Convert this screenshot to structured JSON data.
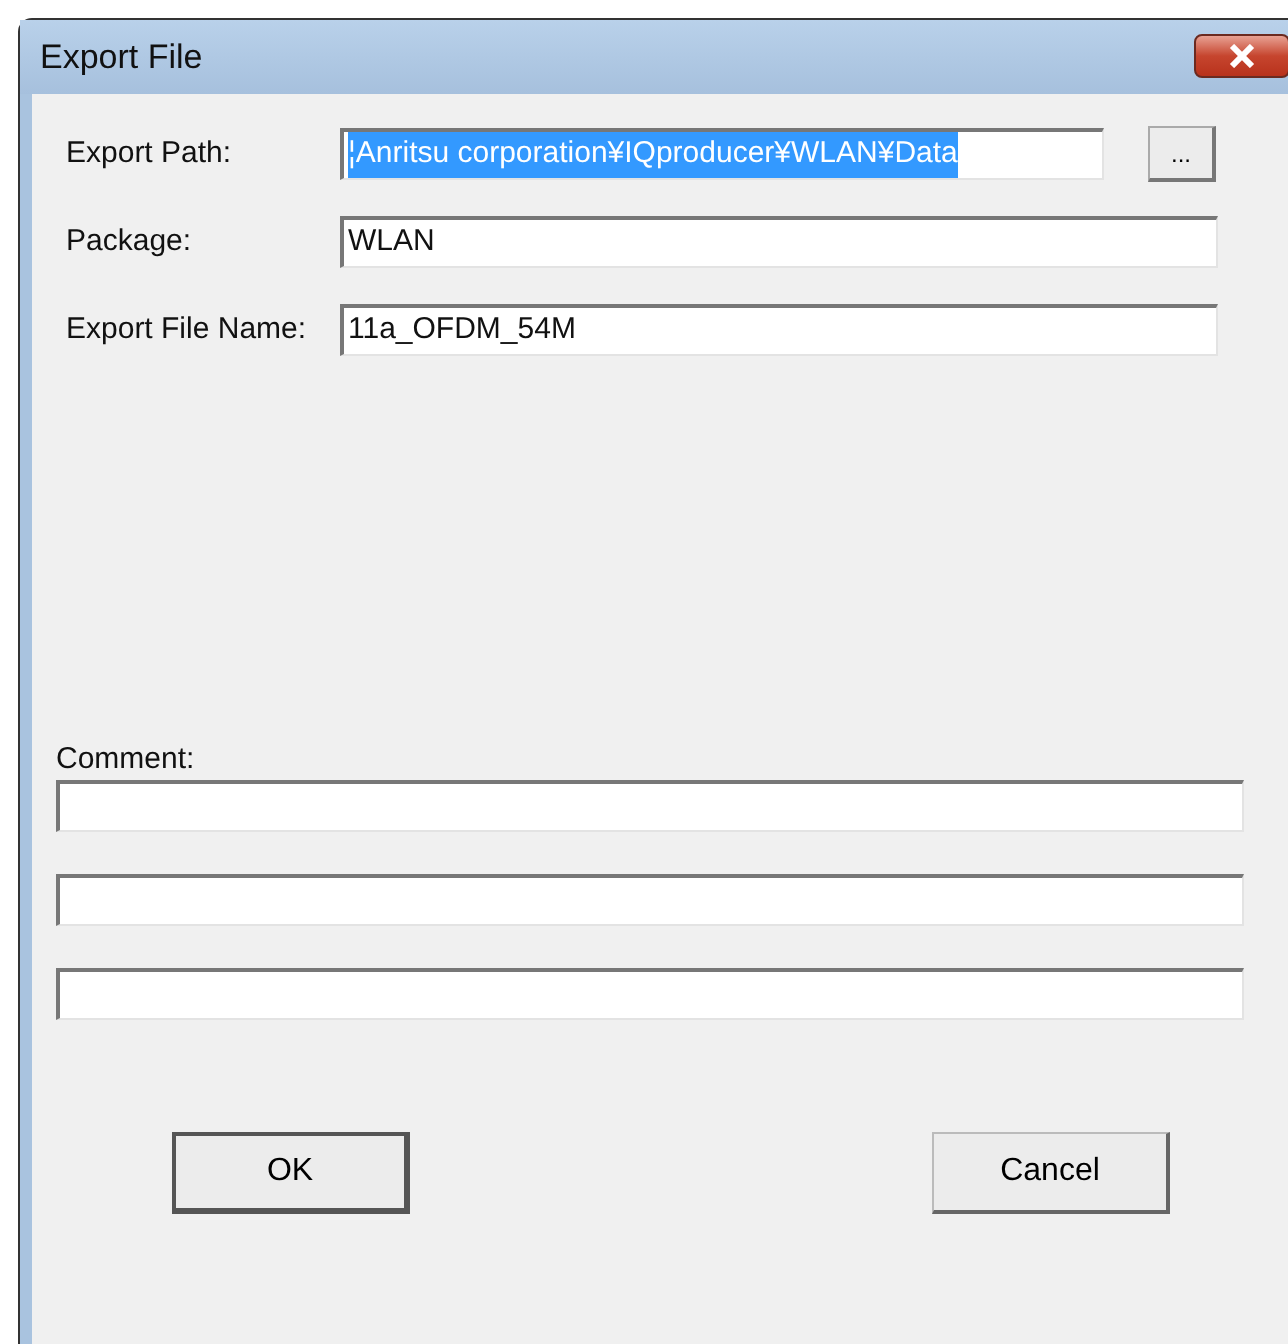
{
  "window": {
    "title": "Export File"
  },
  "fields": [
    {
      "label": "Export Path:",
      "value": "¦Anritsu corporation¥IQproducer¥WLAN¥Data",
      "selected": true,
      "browse": "..."
    },
    {
      "label": "Package:",
      "value": "WLAN",
      "selected": false
    },
    {
      "label": "Export File Name:",
      "value": "11a_OFDM_54M",
      "selected": false
    }
  ],
  "comment": {
    "label": "Comment:",
    "lines": [
      {
        "kind": "text"
      },
      {
        "kind": "text"
      },
      {
        "kind": "text"
      }
    ]
  },
  "buttons": [
    {
      "label": "OK",
      "kind": "default"
    },
    {
      "label": "Cancel",
      "kind": "normal"
    }
  ]
}
